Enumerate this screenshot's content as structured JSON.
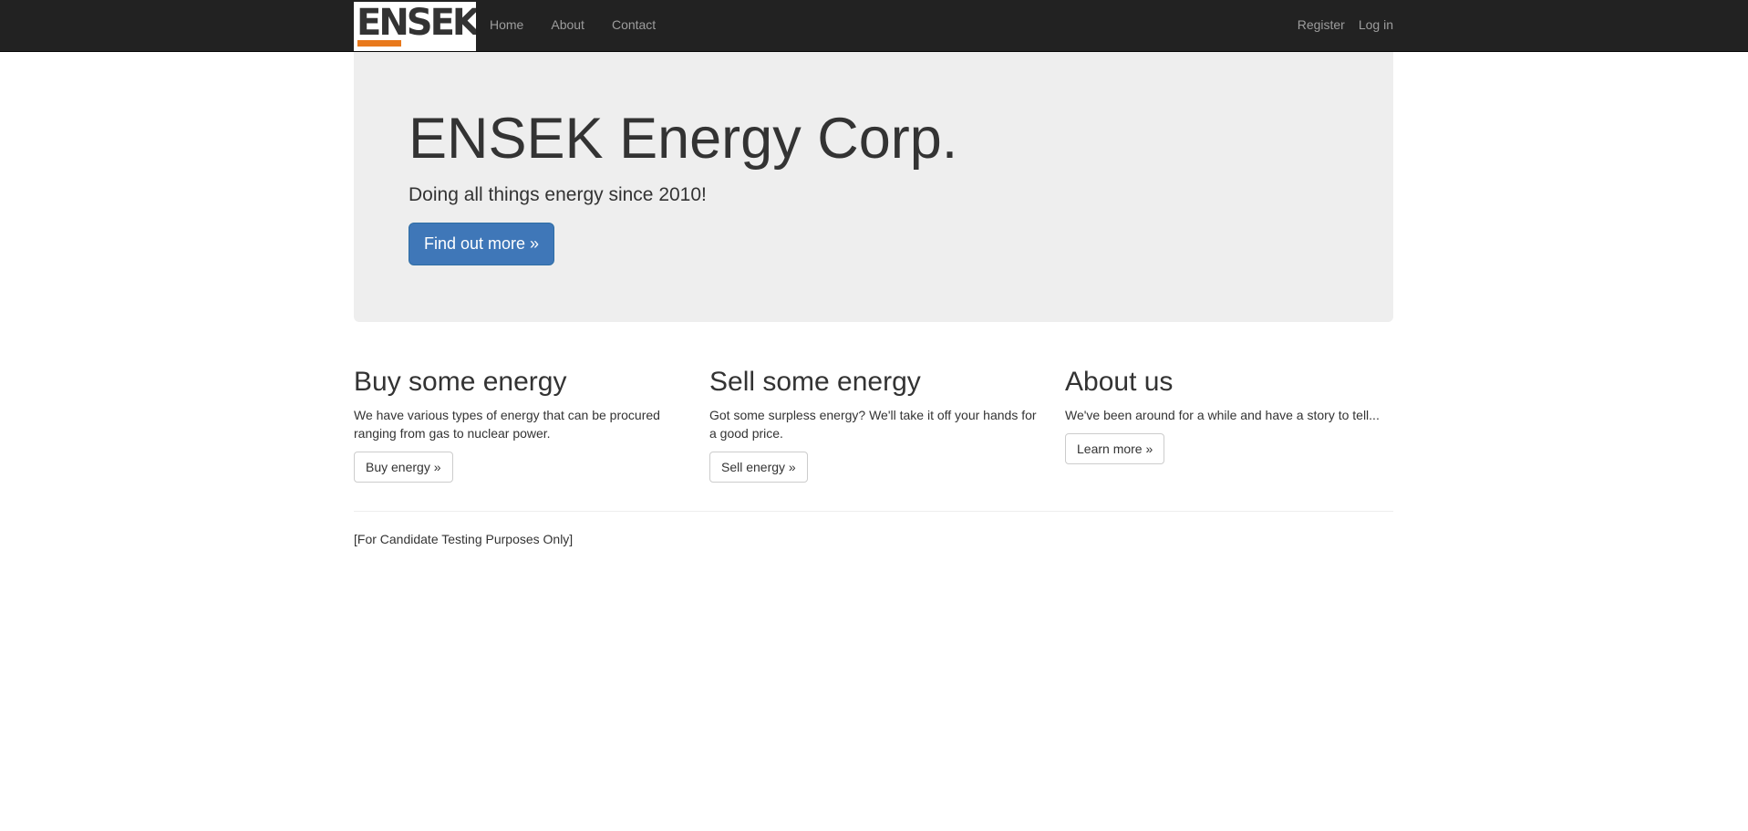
{
  "navbar": {
    "brand": "ENSEK",
    "brand_accent_color": "#e8791c",
    "left_links": [
      {
        "label": "Home"
      },
      {
        "label": "About"
      },
      {
        "label": "Contact"
      }
    ],
    "right_links": [
      {
        "label": "Register"
      },
      {
        "label": "Log in"
      }
    ]
  },
  "hero": {
    "title": "ENSEK Energy Corp.",
    "lead": "Doing all things energy since 2010!",
    "button_label": "Find out more »",
    "button_color": "#3f77b8"
  },
  "columns": [
    {
      "heading": "Buy some energy",
      "text": "We have various types of energy that can be procured ranging from gas to nuclear power.",
      "button_label": "Buy energy »"
    },
    {
      "heading": "Sell some energy",
      "text": "Got some surpless energy? We'll take it off your hands for a good price.",
      "button_label": "Sell energy »"
    },
    {
      "heading": "About us",
      "text": "We've been around for a while and have a story to tell...",
      "button_label": "Learn more »"
    }
  ],
  "footer": {
    "text": "[For Candidate Testing Purposes Only]"
  }
}
